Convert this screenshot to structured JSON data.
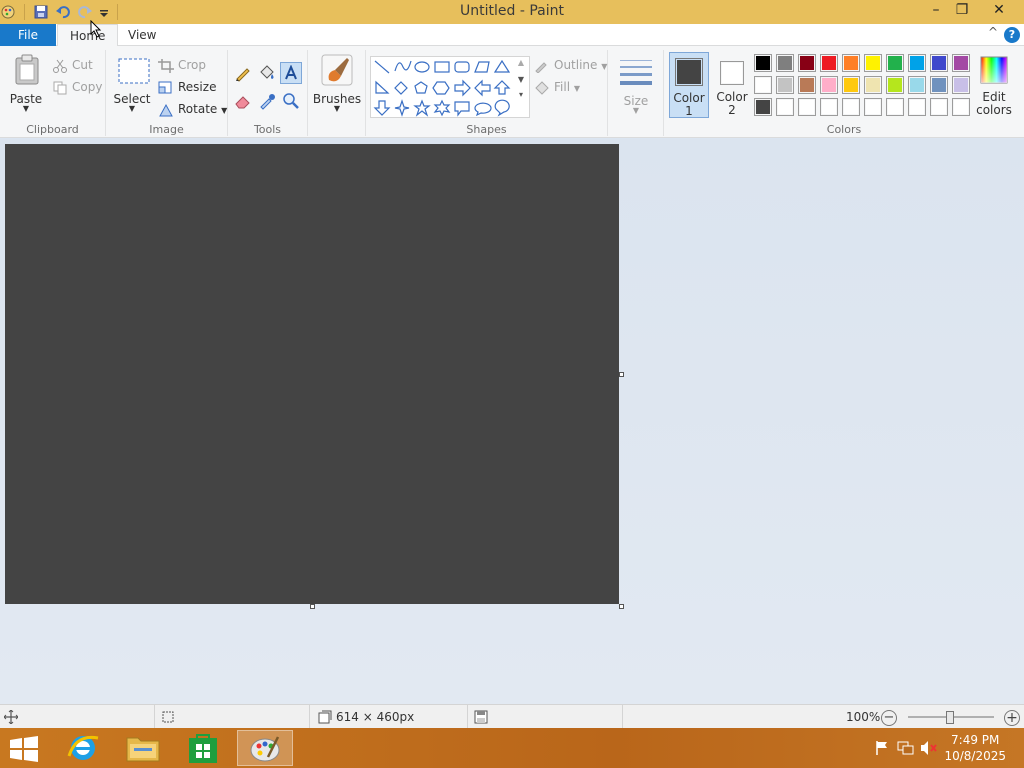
{
  "window": {
    "title": "Untitled - Paint",
    "min_glyph": "–",
    "restore_glyph": "❐",
    "close_glyph": "✕"
  },
  "quick_access": [
    "paint-app-icon",
    "save-icon",
    "undo-icon",
    "redo-icon",
    "customize-quick-access-icon"
  ],
  "tabs": {
    "file": "File",
    "home": "Home",
    "view": "View",
    "help": "?",
    "collapse": "^"
  },
  "clipboard": {
    "paste": "Paste",
    "cut": "Cut",
    "copy": "Copy",
    "label": "Clipboard"
  },
  "image": {
    "select": "Select",
    "crop": "Crop",
    "resize": "Resize",
    "rotate": "Rotate",
    "label": "Image"
  },
  "tools": {
    "label": "Tools"
  },
  "brushes": {
    "label": "Brushes"
  },
  "shapes": {
    "outline": "Outline",
    "fill": "Fill",
    "label": "Shapes"
  },
  "size": {
    "label": "Size"
  },
  "colors": {
    "color1_l1": "Color",
    "color1_l2": "1",
    "color2_l1": "Color",
    "color2_l2": "2",
    "edit_l1": "Edit",
    "edit_l2": "colors",
    "label": "Colors",
    "color1_value": "#444444",
    "color2_value": "#ffffff",
    "palette_row1": [
      "#000000",
      "#7f7f7f",
      "#880015",
      "#ed1c24",
      "#ff7f27",
      "#fff200",
      "#22b14c",
      "#00a2e8",
      "#3f48cc",
      "#a349a4"
    ],
    "palette_row2": [
      "#ffffff",
      "#c3c3c3",
      "#b97a57",
      "#ffaec9",
      "#ffc90e",
      "#efe4b0",
      "#b5e61d",
      "#99d9ea",
      "#7092be",
      "#c8bfe7"
    ],
    "palette_row3": [
      "#444444",
      "#ffffff",
      "#ffffff",
      "#ffffff",
      "#ffffff",
      "#ffffff",
      "#ffffff",
      "#ffffff",
      "#ffffff",
      "#ffffff"
    ]
  },
  "canvas": {
    "fill": "#444444"
  },
  "status": {
    "dimensions": "614 × 460px",
    "zoom": "100%",
    "zoom_minus": "−",
    "zoom_plus": "+"
  },
  "taskbar": {
    "time": "7:49 PM",
    "date": "10/8/2025"
  }
}
